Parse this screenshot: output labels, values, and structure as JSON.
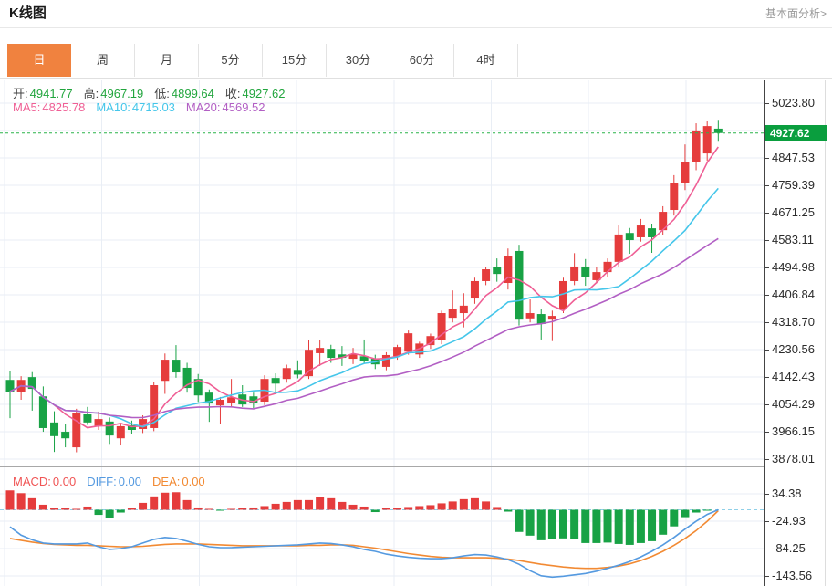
{
  "header": {
    "title": "K线图",
    "link": "基本面分析>"
  },
  "tabs": {
    "items": [
      "日",
      "周",
      "月",
      "5分",
      "15分",
      "30分",
      "60分",
      "4时"
    ],
    "active": "日"
  },
  "ohlc_legend": {
    "items": [
      {
        "label": "开:",
        "value": "4941.77"
      },
      {
        "label": "高:",
        "value": "4967.19"
      },
      {
        "label": "低:",
        "value": "4899.64"
      },
      {
        "label": "收:",
        "value": "4927.62"
      }
    ]
  },
  "ma_legend": {
    "items": [
      {
        "label": "MA5:",
        "value": "4825.78",
        "color": "#ef5f95"
      },
      {
        "label": "MA10:",
        "value": "4715.03",
        "color": "#45c6ea"
      },
      {
        "label": "MA20:",
        "value": "4569.52",
        "color": "#b25fc4"
      }
    ]
  },
  "macd_legend": {
    "items": [
      {
        "label": "MACD:",
        "value": "0.00",
        "color": "#f05555"
      },
      {
        "label": "DIFF:",
        "value": "0.00",
        "color": "#559ae0"
      },
      {
        "label": "DEA:",
        "value": "0.00",
        "color": "#f28a33"
      }
    ]
  },
  "price_badge": {
    "value": "4927.62"
  },
  "colors": {
    "up": "#e53c3c",
    "down": "#18a245",
    "badge": "#0a9e3e",
    "dotted_line": "#2ab44a",
    "grid": "#e9eef5",
    "ohlc_value": "#21a53d",
    "tab_active_bg": "#f0823f",
    "ma5": "#ef5f95",
    "ma10": "#45c6ea",
    "ma20": "#b25fc4",
    "diff": "#559ae0",
    "dea": "#f28a33",
    "zero_line": "#8fd0e8"
  },
  "chart_data": {
    "type": "candlestick",
    "title": "K线图",
    "interval": "日",
    "y_axis_labels": [
      "5023.80",
      "4847.53",
      "4759.39",
      "4671.25",
      "4583.11",
      "4494.98",
      "4406.84",
      "4318.70",
      "4230.56",
      "4142.43",
      "4054.29",
      "3966.15",
      "3878.01"
    ],
    "y_range": [
      3878.01,
      5023.8
    ],
    "current_price": 4927.62,
    "ohlc_last": {
      "open": 4941.77,
      "high": 4967.19,
      "low": 4899.64,
      "close": 4927.62
    },
    "ma_periods": [
      5,
      10,
      20
    ],
    "ma_last_values": {
      "MA5": 4825.78,
      "MA10": 4715.03,
      "MA20": 4569.52
    },
    "candles_ohlc": [
      [
        4133,
        4160,
        4010,
        4095
      ],
      [
        4095,
        4145,
        4069,
        4133
      ],
      [
        4142,
        4158,
        4034,
        4104
      ],
      [
        4080,
        4112,
        3966,
        3978
      ],
      [
        3996,
        4032,
        3901,
        3952
      ],
      [
        3966,
        3992,
        3916,
        3945
      ],
      [
        3916,
        4040,
        3900,
        4025
      ],
      [
        4022,
        4046,
        3988,
        3996
      ],
      [
        3984,
        4031,
        3972,
        4007
      ],
      [
        3999,
        4012,
        3927,
        3954
      ],
      [
        3945,
        3992,
        3922,
        3984
      ],
      [
        3987,
        4002,
        3958,
        3972
      ],
      [
        3975,
        4019,
        3962,
        4007
      ],
      [
        3978,
        4125,
        3968,
        4116
      ],
      [
        4130,
        4218,
        4088,
        4198
      ],
      [
        4198,
        4245,
        4140,
        4157
      ],
      [
        4172,
        4188,
        4092,
        4107
      ],
      [
        4136,
        4152,
        4062,
        4083
      ],
      [
        4092,
        4102,
        3998,
        4057
      ],
      [
        4051,
        4078,
        3992,
        4069
      ],
      [
        4060,
        4136,
        4048,
        4077
      ],
      [
        4086,
        4116,
        4046,
        4054
      ],
      [
        4080,
        4092,
        4042,
        4060
      ],
      [
        4063,
        4148,
        4052,
        4136
      ],
      [
        4139,
        4154,
        4094,
        4121
      ],
      [
        4136,
        4182,
        4124,
        4171
      ],
      [
        4165,
        4196,
        4138,
        4150
      ],
      [
        4145,
        4262,
        4136,
        4230
      ],
      [
        4219,
        4262,
        4178,
        4236
      ],
      [
        4233,
        4246,
        4188,
        4204
      ],
      [
        4215,
        4242,
        4178,
        4204
      ],
      [
        4201,
        4236,
        4184,
        4215
      ],
      [
        4209,
        4263,
        4186,
        4195
      ],
      [
        4201,
        4214,
        4168,
        4183
      ],
      [
        4175,
        4222,
        4164,
        4213
      ],
      [
        4209,
        4246,
        4198,
        4239
      ],
      [
        4224,
        4292,
        4214,
        4283
      ],
      [
        4215,
        4256,
        4204,
        4250
      ],
      [
        4245,
        4282,
        4233,
        4274
      ],
      [
        4260,
        4356,
        4248,
        4348
      ],
      [
        4333,
        4421,
        4318,
        4362
      ],
      [
        4348,
        4412,
        4302,
        4372
      ],
      [
        4395,
        4462,
        4378,
        4451
      ],
      [
        4451,
        4497,
        4438,
        4489
      ],
      [
        4495,
        4524,
        4449,
        4474
      ],
      [
        4445,
        4556,
        4424,
        4533
      ],
      [
        4548,
        4568,
        4308,
        4327
      ],
      [
        4331,
        4392,
        4318,
        4348
      ],
      [
        4345,
        4362,
        4263,
        4313
      ],
      [
        4327,
        4356,
        4258,
        4339
      ],
      [
        4362,
        4462,
        4348,
        4451
      ],
      [
        4451,
        4541,
        4438,
        4498
      ],
      [
        4498,
        4522,
        4436,
        4465
      ],
      [
        4454,
        4496,
        4444,
        4480
      ],
      [
        4480,
        4524,
        4464,
        4513
      ],
      [
        4513,
        4630,
        4498,
        4601
      ],
      [
        4606,
        4622,
        4539,
        4583
      ],
      [
        4592,
        4651,
        4578,
        4630
      ],
      [
        4621,
        4636,
        4542,
        4592
      ],
      [
        4615,
        4692,
        4598,
        4674
      ],
      [
        4680,
        4792,
        4662,
        4768
      ],
      [
        4768,
        4891,
        4744,
        4833
      ],
      [
        4833,
        4959,
        4808,
        4936
      ],
      [
        4862,
        4965,
        4838,
        4950
      ],
      [
        4941.77,
        4967.19,
        4899.64,
        4927.62
      ]
    ],
    "macd_panel": {
      "y_axis_labels": [
        "34.38",
        "-24.93",
        "-84.25",
        "-143.56"
      ],
      "last_values": {
        "macd": 0.0,
        "diff": 0.0,
        "dea": 0.0
      },
      "histogram": [
        42,
        36,
        25,
        11,
        4,
        3,
        2,
        7,
        -11,
        -17,
        -6,
        3,
        15,
        29,
        37,
        38,
        21,
        5,
        2,
        -2,
        2,
        3,
        5,
        8,
        13,
        17,
        21,
        21,
        28,
        25,
        17,
        11,
        7,
        -5,
        3,
        3,
        6,
        8,
        10,
        14,
        18,
        23,
        25,
        18,
        6,
        -4,
        -48,
        -56,
        -66,
        -64,
        -62,
        -64,
        -72,
        -72,
        -71,
        -74,
        -76,
        -72,
        -68,
        -54,
        -36,
        -16,
        -6,
        -2,
        0
      ],
      "diff_line": [
        -37,
        -55,
        -65,
        -72,
        -74,
        -74,
        -74,
        -72,
        -80,
        -86,
        -84,
        -80,
        -72,
        -64,
        -60,
        -62,
        -68,
        -75,
        -80,
        -82,
        -82,
        -81,
        -80,
        -79,
        -78,
        -77,
        -76,
        -74,
        -72,
        -73,
        -76,
        -80,
        -86,
        -90,
        -96,
        -100,
        -103,
        -105,
        -106,
        -106,
        -104,
        -100,
        -97,
        -98,
        -102,
        -108,
        -118,
        -132,
        -143,
        -146,
        -144,
        -141,
        -138,
        -133,
        -127,
        -120,
        -112,
        -102,
        -90,
        -76,
        -60,
        -42,
        -25,
        -10,
        0
      ],
      "dea_line": [
        -62,
        -66,
        -70,
        -73,
        -75,
        -76,
        -77,
        -77,
        -78,
        -79,
        -80,
        -80,
        -79,
        -77,
        -75,
        -74,
        -74,
        -74,
        -75,
        -76,
        -77,
        -78,
        -78,
        -78,
        -78,
        -78,
        -78,
        -77,
        -77,
        -76,
        -76,
        -77,
        -80,
        -83,
        -87,
        -91,
        -95,
        -98,
        -101,
        -103,
        -104,
        -104,
        -104,
        -104,
        -105,
        -107,
        -110,
        -114,
        -118,
        -121,
        -124,
        -126,
        -127,
        -127,
        -125,
        -122,
        -117,
        -110,
        -101,
        -90,
        -77,
        -62,
        -45,
        -25,
        -2
      ]
    }
  }
}
